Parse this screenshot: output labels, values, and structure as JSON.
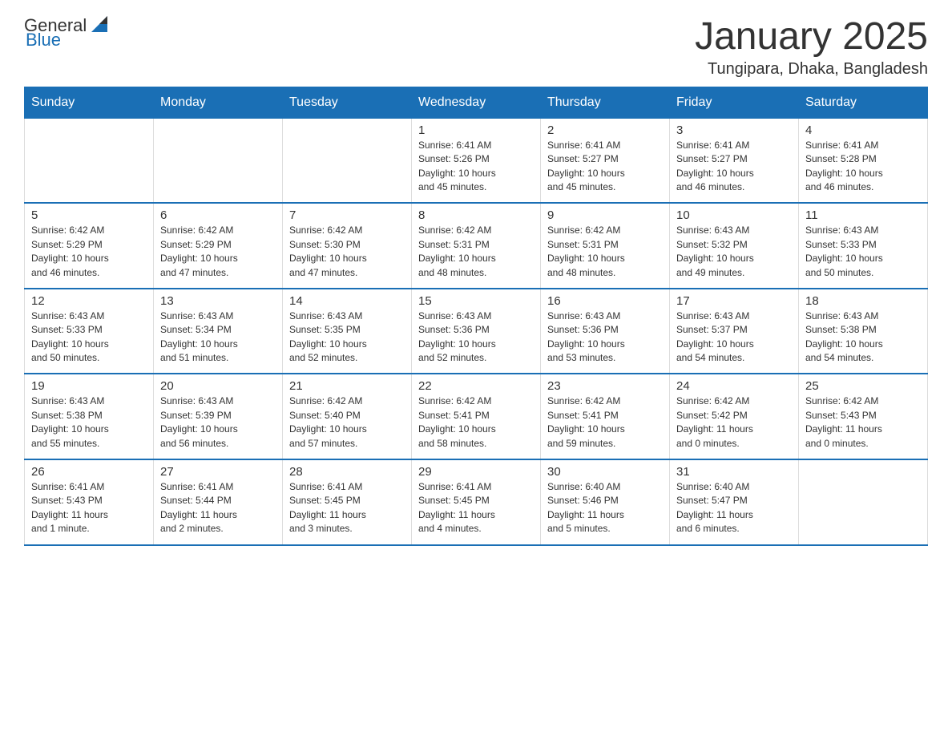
{
  "header": {
    "logo_general": "General",
    "logo_blue": "Blue",
    "month_title": "January 2025",
    "location": "Tungipara, Dhaka, Bangladesh"
  },
  "weekdays": [
    "Sunday",
    "Monday",
    "Tuesday",
    "Wednesday",
    "Thursday",
    "Friday",
    "Saturday"
  ],
  "weeks": [
    [
      {
        "day": "",
        "info": ""
      },
      {
        "day": "",
        "info": ""
      },
      {
        "day": "",
        "info": ""
      },
      {
        "day": "1",
        "info": "Sunrise: 6:41 AM\nSunset: 5:26 PM\nDaylight: 10 hours\nand 45 minutes."
      },
      {
        "day": "2",
        "info": "Sunrise: 6:41 AM\nSunset: 5:27 PM\nDaylight: 10 hours\nand 45 minutes."
      },
      {
        "day": "3",
        "info": "Sunrise: 6:41 AM\nSunset: 5:27 PM\nDaylight: 10 hours\nand 46 minutes."
      },
      {
        "day": "4",
        "info": "Sunrise: 6:41 AM\nSunset: 5:28 PM\nDaylight: 10 hours\nand 46 minutes."
      }
    ],
    [
      {
        "day": "5",
        "info": "Sunrise: 6:42 AM\nSunset: 5:29 PM\nDaylight: 10 hours\nand 46 minutes."
      },
      {
        "day": "6",
        "info": "Sunrise: 6:42 AM\nSunset: 5:29 PM\nDaylight: 10 hours\nand 47 minutes."
      },
      {
        "day": "7",
        "info": "Sunrise: 6:42 AM\nSunset: 5:30 PM\nDaylight: 10 hours\nand 47 minutes."
      },
      {
        "day": "8",
        "info": "Sunrise: 6:42 AM\nSunset: 5:31 PM\nDaylight: 10 hours\nand 48 minutes."
      },
      {
        "day": "9",
        "info": "Sunrise: 6:42 AM\nSunset: 5:31 PM\nDaylight: 10 hours\nand 48 minutes."
      },
      {
        "day": "10",
        "info": "Sunrise: 6:43 AM\nSunset: 5:32 PM\nDaylight: 10 hours\nand 49 minutes."
      },
      {
        "day": "11",
        "info": "Sunrise: 6:43 AM\nSunset: 5:33 PM\nDaylight: 10 hours\nand 50 minutes."
      }
    ],
    [
      {
        "day": "12",
        "info": "Sunrise: 6:43 AM\nSunset: 5:33 PM\nDaylight: 10 hours\nand 50 minutes."
      },
      {
        "day": "13",
        "info": "Sunrise: 6:43 AM\nSunset: 5:34 PM\nDaylight: 10 hours\nand 51 minutes."
      },
      {
        "day": "14",
        "info": "Sunrise: 6:43 AM\nSunset: 5:35 PM\nDaylight: 10 hours\nand 52 minutes."
      },
      {
        "day": "15",
        "info": "Sunrise: 6:43 AM\nSunset: 5:36 PM\nDaylight: 10 hours\nand 52 minutes."
      },
      {
        "day": "16",
        "info": "Sunrise: 6:43 AM\nSunset: 5:36 PM\nDaylight: 10 hours\nand 53 minutes."
      },
      {
        "day": "17",
        "info": "Sunrise: 6:43 AM\nSunset: 5:37 PM\nDaylight: 10 hours\nand 54 minutes."
      },
      {
        "day": "18",
        "info": "Sunrise: 6:43 AM\nSunset: 5:38 PM\nDaylight: 10 hours\nand 54 minutes."
      }
    ],
    [
      {
        "day": "19",
        "info": "Sunrise: 6:43 AM\nSunset: 5:38 PM\nDaylight: 10 hours\nand 55 minutes."
      },
      {
        "day": "20",
        "info": "Sunrise: 6:43 AM\nSunset: 5:39 PM\nDaylight: 10 hours\nand 56 minutes."
      },
      {
        "day": "21",
        "info": "Sunrise: 6:42 AM\nSunset: 5:40 PM\nDaylight: 10 hours\nand 57 minutes."
      },
      {
        "day": "22",
        "info": "Sunrise: 6:42 AM\nSunset: 5:41 PM\nDaylight: 10 hours\nand 58 minutes."
      },
      {
        "day": "23",
        "info": "Sunrise: 6:42 AM\nSunset: 5:41 PM\nDaylight: 10 hours\nand 59 minutes."
      },
      {
        "day": "24",
        "info": "Sunrise: 6:42 AM\nSunset: 5:42 PM\nDaylight: 11 hours\nand 0 minutes."
      },
      {
        "day": "25",
        "info": "Sunrise: 6:42 AM\nSunset: 5:43 PM\nDaylight: 11 hours\nand 0 minutes."
      }
    ],
    [
      {
        "day": "26",
        "info": "Sunrise: 6:41 AM\nSunset: 5:43 PM\nDaylight: 11 hours\nand 1 minute."
      },
      {
        "day": "27",
        "info": "Sunrise: 6:41 AM\nSunset: 5:44 PM\nDaylight: 11 hours\nand 2 minutes."
      },
      {
        "day": "28",
        "info": "Sunrise: 6:41 AM\nSunset: 5:45 PM\nDaylight: 11 hours\nand 3 minutes."
      },
      {
        "day": "29",
        "info": "Sunrise: 6:41 AM\nSunset: 5:45 PM\nDaylight: 11 hours\nand 4 minutes."
      },
      {
        "day": "30",
        "info": "Sunrise: 6:40 AM\nSunset: 5:46 PM\nDaylight: 11 hours\nand 5 minutes."
      },
      {
        "day": "31",
        "info": "Sunrise: 6:40 AM\nSunset: 5:47 PM\nDaylight: 11 hours\nand 6 minutes."
      },
      {
        "day": "",
        "info": ""
      }
    ]
  ]
}
